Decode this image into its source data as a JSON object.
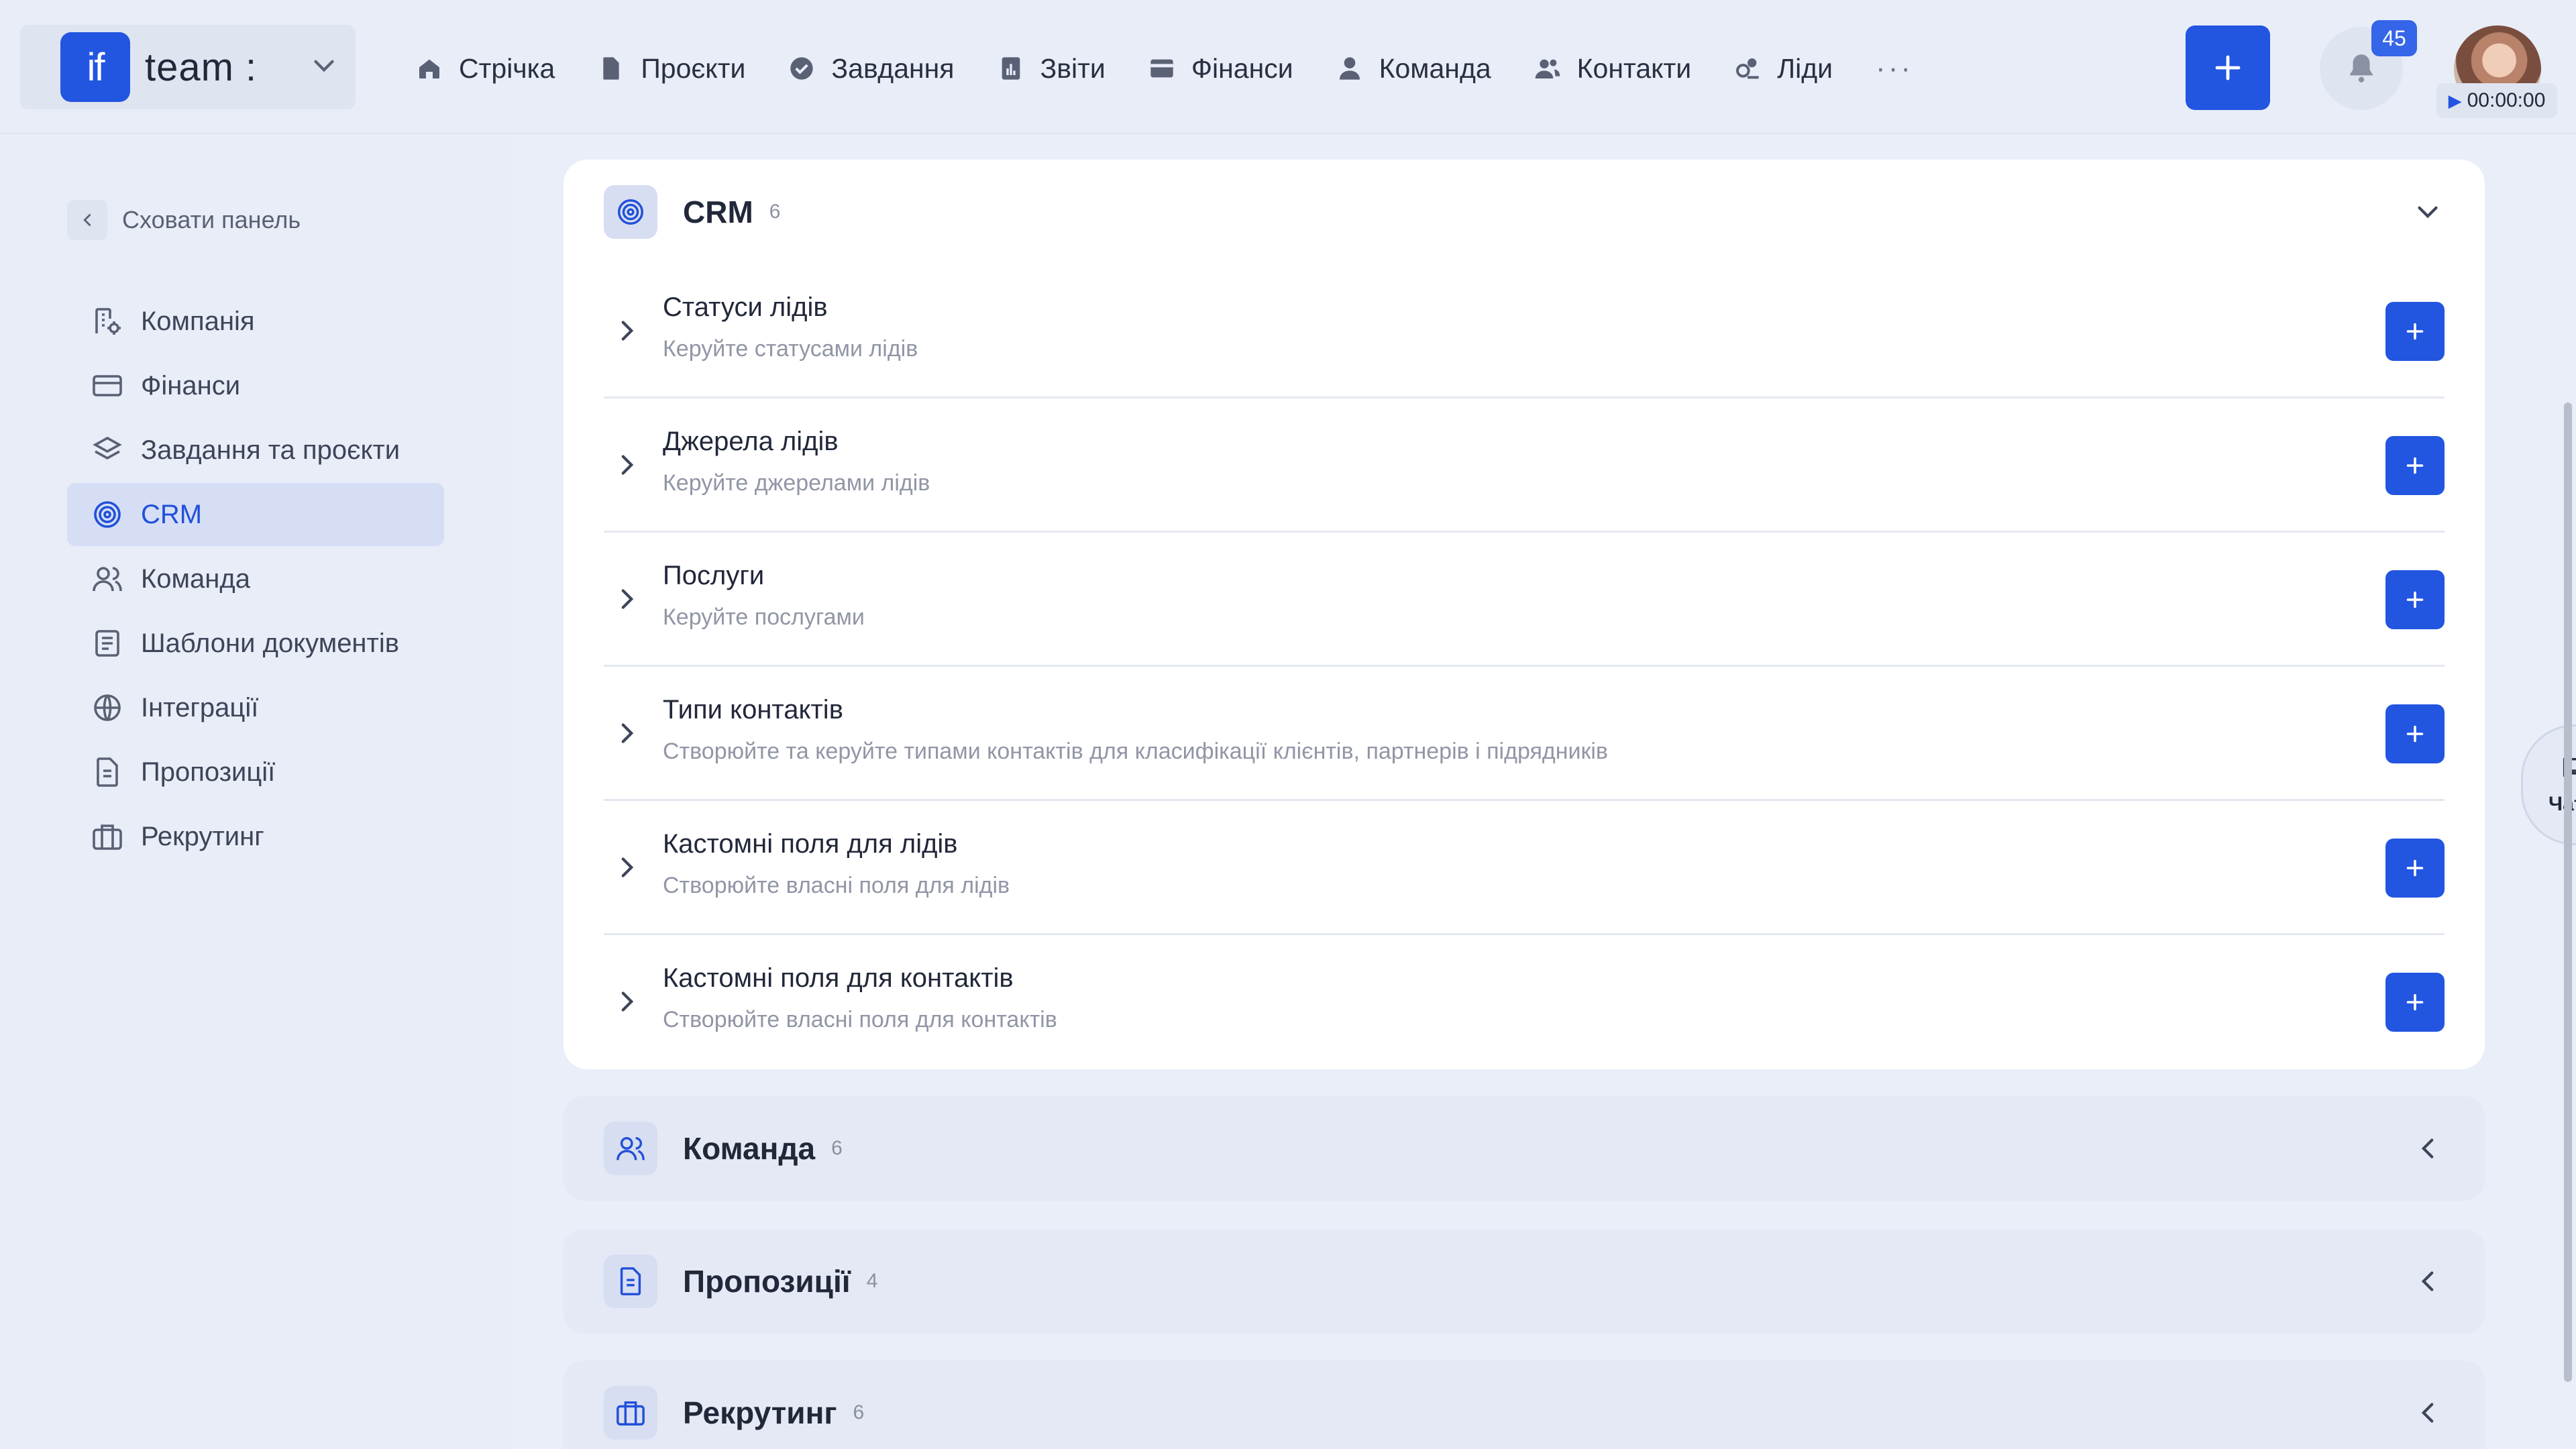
{
  "brand": {
    "logo_mark": "if",
    "workspace": "team :"
  },
  "nav": [
    {
      "label": "Стрічка",
      "icon": "home-icon"
    },
    {
      "label": "Проєкти",
      "icon": "document-icon"
    },
    {
      "label": "Завдання",
      "icon": "check-circle-icon"
    },
    {
      "label": "Звіти",
      "icon": "report-icon"
    },
    {
      "label": "Фінанси",
      "icon": "wallet-icon"
    },
    {
      "label": "Команда",
      "icon": "user-icon"
    },
    {
      "label": "Контакти",
      "icon": "contacts-icon"
    },
    {
      "label": "Ліди",
      "icon": "leads-icon"
    },
    {
      "label": "···",
      "icon": "more-icon"
    }
  ],
  "header": {
    "add_label": "+",
    "notifications_count": "45",
    "timer": "00:00:00"
  },
  "sidebar": {
    "hide_label": "Сховати панель",
    "items": [
      {
        "label": "Компанія",
        "icon": "building-settings-icon"
      },
      {
        "label": "Фінанси",
        "icon": "credit-card-icon"
      },
      {
        "label": "Завдання та проєкти",
        "icon": "layers-icon"
      },
      {
        "label": "CRM",
        "icon": "target-icon",
        "active": true
      },
      {
        "label": "Команда",
        "icon": "team-icon"
      },
      {
        "label": "Шаблони документів",
        "icon": "template-icon"
      },
      {
        "label": "Інтеграції",
        "icon": "globe-icon"
      },
      {
        "label": "Пропозиції",
        "icon": "proposal-icon"
      },
      {
        "label": "Рекрутинг",
        "icon": "briefcase-icon"
      }
    ]
  },
  "crm": {
    "title": "CRM",
    "count": "6",
    "rows": [
      {
        "title": "Статуси лідів",
        "subtitle": "Керуйте статусами лідів"
      },
      {
        "title": "Джерела лідів",
        "subtitle": "Керуйте джерелами лідів"
      },
      {
        "title": "Послуги",
        "subtitle": "Керуйте послугами"
      },
      {
        "title": "Типи контактів",
        "subtitle": "Створюйте та керуйте типами контактів для класифікації клієнтів, партнерів і підрядників"
      },
      {
        "title": "Кастомні поля для лідів",
        "subtitle": "Створюйте власні поля для лідів"
      },
      {
        "title": "Кастомні поля для контактів",
        "subtitle": "Створюйте власні поля для контактів"
      }
    ]
  },
  "sections": [
    {
      "title": "Команда",
      "count": "6",
      "icon": "team-icon"
    },
    {
      "title": "Пропозиції",
      "count": "4",
      "icon": "proposal-icon"
    },
    {
      "title": "Рекрутинг",
      "count": "6",
      "icon": "briefcase-icon"
    }
  ],
  "chats": {
    "label": "Чати"
  },
  "colors": {
    "accent": "#2255e0",
    "active_bg": "#d6def6",
    "page_bg": "#eaeef8"
  }
}
